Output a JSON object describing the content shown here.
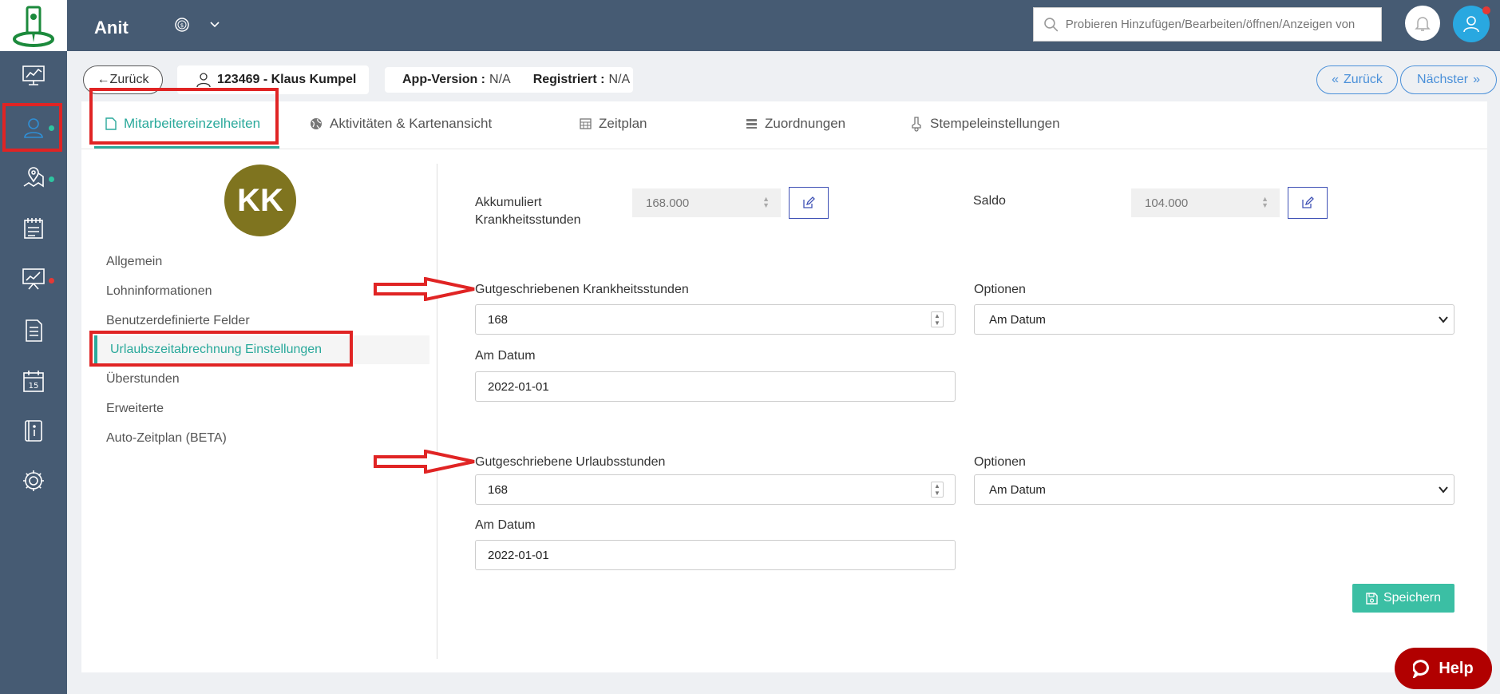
{
  "app": {
    "title": "Anit"
  },
  "search": {
    "placeholder": "Probieren Hinzufügen/Bearbeiten/öffnen/Anzeigen von"
  },
  "header": {
    "back_label": "←Zurück",
    "employee": "123469 - Klaus Kumpel",
    "app_version_label": "App-Version :",
    "app_version_value": "N/A",
    "registered_label": "Registriert :",
    "registered_value": "N/A",
    "prev_label": "Zurück",
    "next_label": "Nächster"
  },
  "tabs": [
    {
      "label": "Mitarbeitereinzelheiten"
    },
    {
      "label": "Aktivitäten & Kartenansicht"
    },
    {
      "label": "Zeitplan"
    },
    {
      "label": "Zuordnungen"
    },
    {
      "label": "Stempeleinstellungen"
    }
  ],
  "profile": {
    "initials": "KK"
  },
  "side_menu": [
    {
      "label": "Allgemein"
    },
    {
      "label": "Lohninformationen"
    },
    {
      "label": "Benutzerdefinierte Felder"
    },
    {
      "label": "Urlaubszeitabrechnung Einstellungen"
    },
    {
      "label": "Überstunden"
    },
    {
      "label": "Erweiterte"
    },
    {
      "label": "Auto-Zeitplan (BETA)"
    }
  ],
  "form": {
    "accum_label_1": "Akkumuliert",
    "accum_label_2": "Krankheitsstunden",
    "accum_value": "168.000",
    "saldo_label": "Saldo",
    "saldo_value": "104.000",
    "sick": {
      "label": "Gutgeschriebenen Krankheitsstunden",
      "value": "168",
      "options_label": "Optionen",
      "option_selected": "Am Datum",
      "date_label": "Am Datum",
      "date_value": "2022-01-01"
    },
    "vacation": {
      "label": "Gutgeschriebene Urlaubsstunden",
      "value": "168",
      "options_label": "Optionen",
      "option_selected": "Am Datum",
      "date_label": "Am Datum",
      "date_value": "2022-01-01"
    },
    "save_label": "Speichern"
  },
  "help": {
    "label": "Help"
  },
  "colors": {
    "sidebar": "#465b73",
    "accent": "#2aa99b",
    "highlight": "#e02424",
    "avatar": "#7f741f",
    "save": "#3bbfa4",
    "help": "#b10000"
  }
}
